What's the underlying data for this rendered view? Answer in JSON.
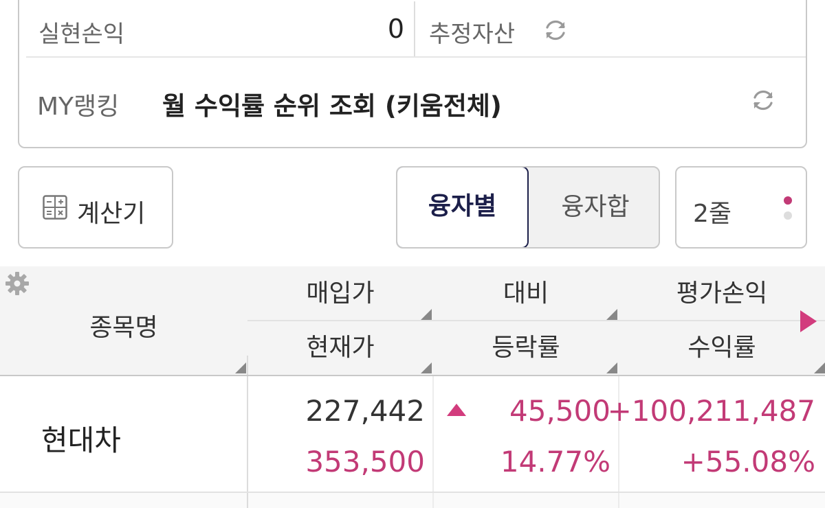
{
  "summary": {
    "realized_pl_label": "실현손익",
    "realized_pl_value": "0",
    "estimated_assets_label": "추정자산",
    "my_ranking_label": "MY랭킹",
    "my_ranking_text": "월 수익률 순위 조회 (키움전체)"
  },
  "controls": {
    "calculator_label": "계산기",
    "segment": {
      "options": [
        "융자별",
        "융자합"
      ],
      "selected": "융자별"
    },
    "lines_label": "2줄"
  },
  "table": {
    "headers": {
      "name": "종목명",
      "col1_top": "매입가",
      "col1_bottom": "현재가",
      "col2_top": "대비",
      "col2_bottom": "등락률",
      "col3_top": "평가손익",
      "col3_bottom": "수익률"
    },
    "rows": [
      {
        "name": "현대차",
        "purchase_price": "227,442",
        "current_price": "353,500",
        "change": "45,500",
        "change_rate": "14.77%",
        "eval_pl": "+100,211,487",
        "return_rate": "+55.08%",
        "direction": "up"
      }
    ]
  },
  "colors": {
    "accent_pink": "#c23a76",
    "navy": "#1c1f4a"
  },
  "icons": [
    "refresh-icon",
    "calculator-icon",
    "gear-icon",
    "next-columns-arrow-icon",
    "up-triangle-icon"
  ]
}
